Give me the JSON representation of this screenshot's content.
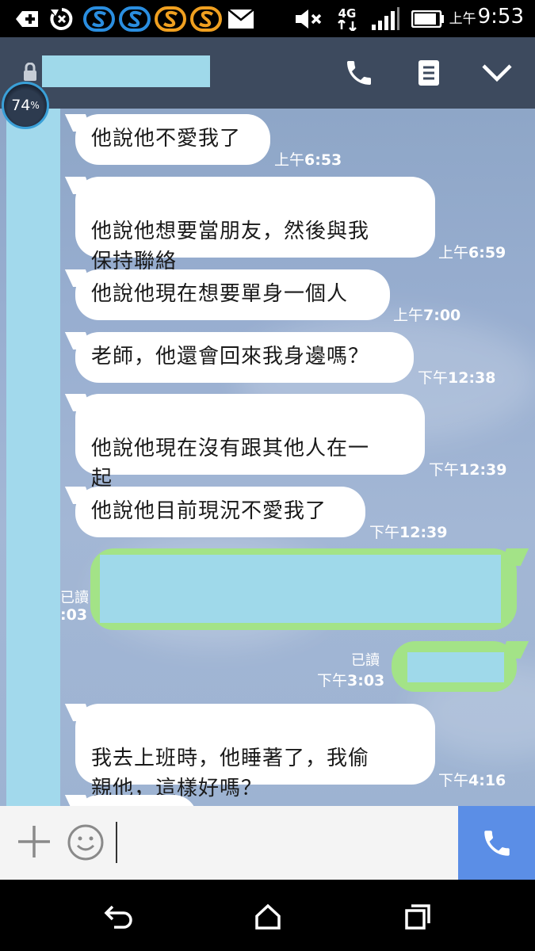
{
  "status_bar": {
    "time": "9:53",
    "ampm": "上午",
    "network": "4G",
    "battery_badge": "74",
    "battery_unit": "%",
    "icons": [
      "add-box-icon",
      "sync-icon",
      "s-app-icon-blue",
      "s-app-icon-blue",
      "s-app-icon-orange",
      "s-app-icon-orange",
      "mail-icon",
      "mute-icon",
      "4g-icon",
      "signal-icon",
      "battery-icon"
    ]
  },
  "header": {
    "icons": [
      "lock-icon",
      "phone-icon",
      "notes-icon",
      "chevron-down-icon"
    ]
  },
  "messages": [
    {
      "text": "他說他不愛我了",
      "time_prefix": "上午",
      "time": "6:53"
    },
    {
      "text": "他說他想要當朋友，然後與我\n保持聯絡",
      "time_prefix": "上午",
      "time": "6:59"
    },
    {
      "text": "他說他現在想要單身一個人",
      "time_prefix": "上午",
      "time": "7:00"
    },
    {
      "text": "老師，他還會回來我身邊嗎？",
      "time_prefix": "下午",
      "time": "12:38"
    },
    {
      "text": "他說他現在沒有跟其他人在一\n起",
      "time_prefix": "下午",
      "time": "12:39"
    },
    {
      "text": "他說他目前現況不愛我了",
      "time_prefix": "下午",
      "time": "12:39"
    },
    {
      "text": "我去上班時，他睡著了，我偷\n親他，這樣好嗎？",
      "time_prefix": "下午",
      "time": "4:16"
    }
  ],
  "sent": [
    {
      "read": "已讀",
      "time_fragment": ":03"
    },
    {
      "read": "已讀",
      "time_prefix": "下午",
      "time": "3:03"
    }
  ],
  "sent_read_partial": "已讀",
  "input": {
    "placeholder": ""
  },
  "nav": {
    "icons": [
      "back-icon",
      "home-icon",
      "recents-icon"
    ]
  },
  "colors": {
    "header": "#3d4a5e",
    "sent_bubble": "#a3e387",
    "call_button": "#5b8ee6",
    "redaction": "#9fd9ea"
  }
}
